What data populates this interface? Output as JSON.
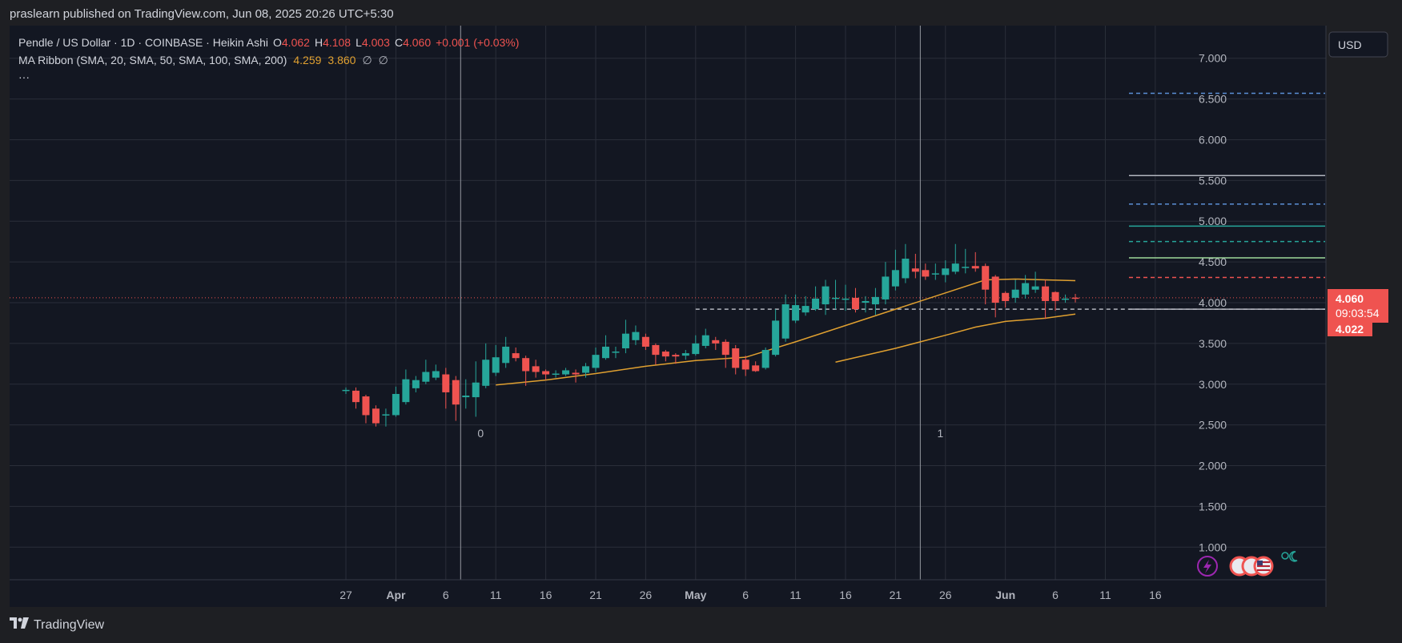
{
  "header": {
    "publisher": "praslearn published on TradingView.com, Jun 08, 2025 20:26 UTC+5:30"
  },
  "legend": {
    "symbol": "Pendle / US Dollar · 1D · COINBASE · Heikin Ashi",
    "o_label": "O",
    "o_value": "4.062",
    "h_label": "H",
    "h_value": "4.108",
    "l_label": "L",
    "l_value": "4.003",
    "c_label": "C",
    "c_value": "4.060",
    "change": "+0.001 (+0.03%)",
    "ma_label": "MA Ribbon (SMA, 20, SMA, 50, SMA, 100, SMA, 200)",
    "ma_values": [
      "4.259",
      "3.860",
      "∅",
      "∅"
    ],
    "more": "···"
  },
  "currency_button": "USD",
  "price_label": {
    "price": "4.060",
    "countdown": "09:03:54",
    "low_level": "4.022"
  },
  "footer": {
    "brand": "TradingView"
  },
  "colors": {
    "up": "#26a69a",
    "down": "#ef5350",
    "ma": "#e0a030",
    "bg": "#131722",
    "grid": "#2a2e39"
  },
  "icons": [
    "tradingview-logo-icon",
    "lightning-icon",
    "us-flag-event-icon",
    "market-session-icon"
  ],
  "chart_data": {
    "type": "candlestick",
    "style": "Heikin Ashi",
    "y_ticks": [
      "1.000",
      "1.500",
      "2.000",
      "2.500",
      "3.000",
      "3.500",
      "4.000",
      "4.500",
      "5.000",
      "5.500",
      "6.000",
      "6.500",
      "7.000"
    ],
    "ylim": [
      0.6,
      7.4
    ],
    "x_ticks": [
      {
        "label": "27",
        "day": 0
      },
      {
        "label": "Apr",
        "day": 5
      },
      {
        "label": "6",
        "day": 10
      },
      {
        "label": "11",
        "day": 15
      },
      {
        "label": "16",
        "day": 20
      },
      {
        "label": "21",
        "day": 25
      },
      {
        "label": "26",
        "day": 30
      },
      {
        "label": "May",
        "day": 35
      },
      {
        "label": "6",
        "day": 40
      },
      {
        "label": "11",
        "day": 45
      },
      {
        "label": "16",
        "day": 50
      },
      {
        "label": "21",
        "day": 55
      },
      {
        "label": "26",
        "day": 60
      },
      {
        "label": "Jun",
        "day": 66
      },
      {
        "label": "6",
        "day": 71
      },
      {
        "label": "11",
        "day": 76
      },
      {
        "label": "16",
        "day": 81
      }
    ],
    "candles": [
      [
        2.92,
        2.93,
        2.96,
        2.88
      ],
      [
        2.92,
        2.78,
        2.96,
        2.7
      ],
      [
        2.85,
        2.62,
        2.87,
        2.52
      ],
      [
        2.7,
        2.52,
        2.74,
        2.48
      ],
      [
        2.62,
        2.63,
        2.7,
        2.48
      ],
      [
        2.62,
        2.88,
        2.97,
        2.6
      ],
      [
        2.78,
        3.06,
        3.18,
        2.75
      ],
      [
        2.95,
        3.05,
        3.1,
        2.9
      ],
      [
        3.03,
        3.15,
        3.3,
        3.0
      ],
      [
        3.08,
        3.16,
        3.24,
        3.05
      ],
      [
        3.12,
        2.9,
        3.2,
        2.7
      ],
      [
        3.05,
        2.75,
        3.1,
        2.55
      ],
      [
        2.84,
        2.86,
        3.06,
        2.7
      ],
      [
        2.84,
        3.02,
        3.28,
        2.6
      ],
      [
        2.98,
        3.3,
        3.5,
        2.95
      ],
      [
        3.14,
        3.33,
        3.48,
        3.1
      ],
      [
        3.26,
        3.46,
        3.58,
        3.2
      ],
      [
        3.38,
        3.32,
        3.45,
        3.28
      ],
      [
        3.32,
        3.16,
        3.35,
        2.98
      ],
      [
        3.22,
        3.15,
        3.3,
        3.08
      ],
      [
        3.16,
        3.12,
        3.18,
        3.05
      ],
      [
        3.13,
        3.13,
        3.17,
        3.08
      ],
      [
        3.12,
        3.17,
        3.2,
        3.1
      ],
      [
        3.14,
        3.12,
        3.18,
        3.02
      ],
      [
        3.14,
        3.22,
        3.26,
        3.08
      ],
      [
        3.2,
        3.36,
        3.45,
        3.15
      ],
      [
        3.32,
        3.46,
        3.6,
        3.3
      ],
      [
        3.4,
        3.4,
        3.46,
        3.32
      ],
      [
        3.44,
        3.62,
        3.79,
        3.38
      ],
      [
        3.54,
        3.64,
        3.72,
        3.48
      ],
      [
        3.58,
        3.46,
        3.62,
        3.42
      ],
      [
        3.48,
        3.36,
        3.5,
        3.24
      ],
      [
        3.4,
        3.34,
        3.42,
        3.28
      ],
      [
        3.36,
        3.34,
        3.38,
        3.25
      ],
      [
        3.35,
        3.38,
        3.42,
        3.3
      ],
      [
        3.37,
        3.5,
        3.6,
        3.35
      ],
      [
        3.47,
        3.6,
        3.68,
        3.44
      ],
      [
        3.54,
        3.5,
        3.58,
        3.42
      ],
      [
        3.52,
        3.36,
        3.55,
        3.2
      ],
      [
        3.44,
        3.2,
        3.48,
        3.12
      ],
      [
        3.3,
        3.18,
        3.35,
        3.1
      ],
      [
        3.23,
        3.16,
        3.28,
        3.15
      ],
      [
        3.2,
        3.42,
        3.45,
        3.18
      ],
      [
        3.36,
        3.78,
        3.92,
        3.34
      ],
      [
        3.56,
        3.98,
        4.1,
        3.52
      ],
      [
        3.78,
        3.97,
        4.1,
        3.75
      ],
      [
        3.88,
        3.96,
        4.08,
        3.84
      ],
      [
        3.92,
        4.05,
        4.2,
        3.9
      ],
      [
        3.98,
        4.2,
        4.28,
        3.85
      ],
      [
        4.06,
        4.06,
        4.28,
        3.92
      ],
      [
        4.05,
        4.05,
        4.22,
        3.9
      ],
      [
        4.06,
        3.92,
        4.18,
        3.88
      ],
      [
        4.0,
        4.02,
        4.08,
        3.88
      ],
      [
        3.98,
        4.07,
        4.18,
        3.85
      ],
      [
        4.04,
        4.32,
        4.5,
        3.98
      ],
      [
        4.2,
        4.4,
        4.65,
        4.15
      ],
      [
        4.3,
        4.54,
        4.72,
        4.24
      ],
      [
        4.42,
        4.38,
        4.6,
        4.3
      ],
      [
        4.4,
        4.32,
        4.48,
        4.28
      ],
      [
        4.36,
        4.36,
        4.48,
        4.28
      ],
      [
        4.34,
        4.42,
        4.52,
        4.25
      ],
      [
        4.38,
        4.48,
        4.72,
        4.35
      ],
      [
        4.44,
        4.44,
        4.66,
        4.36
      ],
      [
        4.45,
        4.42,
        4.62,
        4.38
      ],
      [
        4.45,
        4.16,
        4.48,
        3.98
      ],
      [
        4.32,
        4.0,
        4.34,
        3.82
      ],
      [
        4.12,
        4.02,
        4.14,
        3.94
      ],
      [
        4.06,
        4.16,
        4.28,
        4.0
      ],
      [
        4.1,
        4.24,
        4.34,
        4.05
      ],
      [
        4.16,
        4.2,
        4.38,
        4.12
      ],
      [
        4.2,
        4.02,
        4.28,
        3.8
      ],
      [
        4.13,
        4.02,
        4.14,
        3.9
      ],
      [
        4.05,
        4.05,
        4.1,
        4.0
      ],
      [
        4.062,
        4.06,
        4.108,
        4.003
      ]
    ],
    "ma_20": [
      [
        15,
        2.99
      ],
      [
        20,
        3.05
      ],
      [
        25,
        3.13
      ],
      [
        30,
        3.22
      ],
      [
        35,
        3.29
      ],
      [
        40,
        3.33
      ],
      [
        45,
        3.52
      ],
      [
        50,
        3.72
      ],
      [
        55,
        3.92
      ],
      [
        60,
        4.12
      ],
      [
        64,
        4.28
      ],
      [
        67,
        4.29
      ],
      [
        70,
        4.28
      ],
      [
        73,
        4.27
      ]
    ],
    "ma_50": [
      [
        49,
        3.27
      ],
      [
        55,
        3.44
      ],
      [
        60,
        3.6
      ],
      [
        63,
        3.7
      ],
      [
        66,
        3.77
      ],
      [
        70,
        3.81
      ],
      [
        73,
        3.86
      ]
    ],
    "last_price": 4.06,
    "horizontal_levels": [
      {
        "price": 6.57,
        "color": "#5b8fd6",
        "dash": true
      },
      {
        "price": 5.56,
        "color": "#b2b5be",
        "dash": false
      },
      {
        "price": 5.21,
        "color": "#5b8fd6",
        "dash": true
      },
      {
        "price": 4.94,
        "color": "#26a69a",
        "dash": false
      },
      {
        "price": 4.75,
        "color": "#26a69a",
        "dash": true
      },
      {
        "price": 4.55,
        "color": "#9ed89a",
        "dash": false
      },
      {
        "price": 4.31,
        "color": "#ef5350",
        "dash": true
      },
      {
        "price": 3.92,
        "color": "#b2b5be",
        "dash": false
      },
      {
        "price": 3.92,
        "color": "#b2b5be",
        "dash": true,
        "from_day": 35
      }
    ],
    "vertical_markers": [
      {
        "label": "0",
        "day": 11
      },
      {
        "label": "1",
        "day": 57
      }
    ]
  }
}
